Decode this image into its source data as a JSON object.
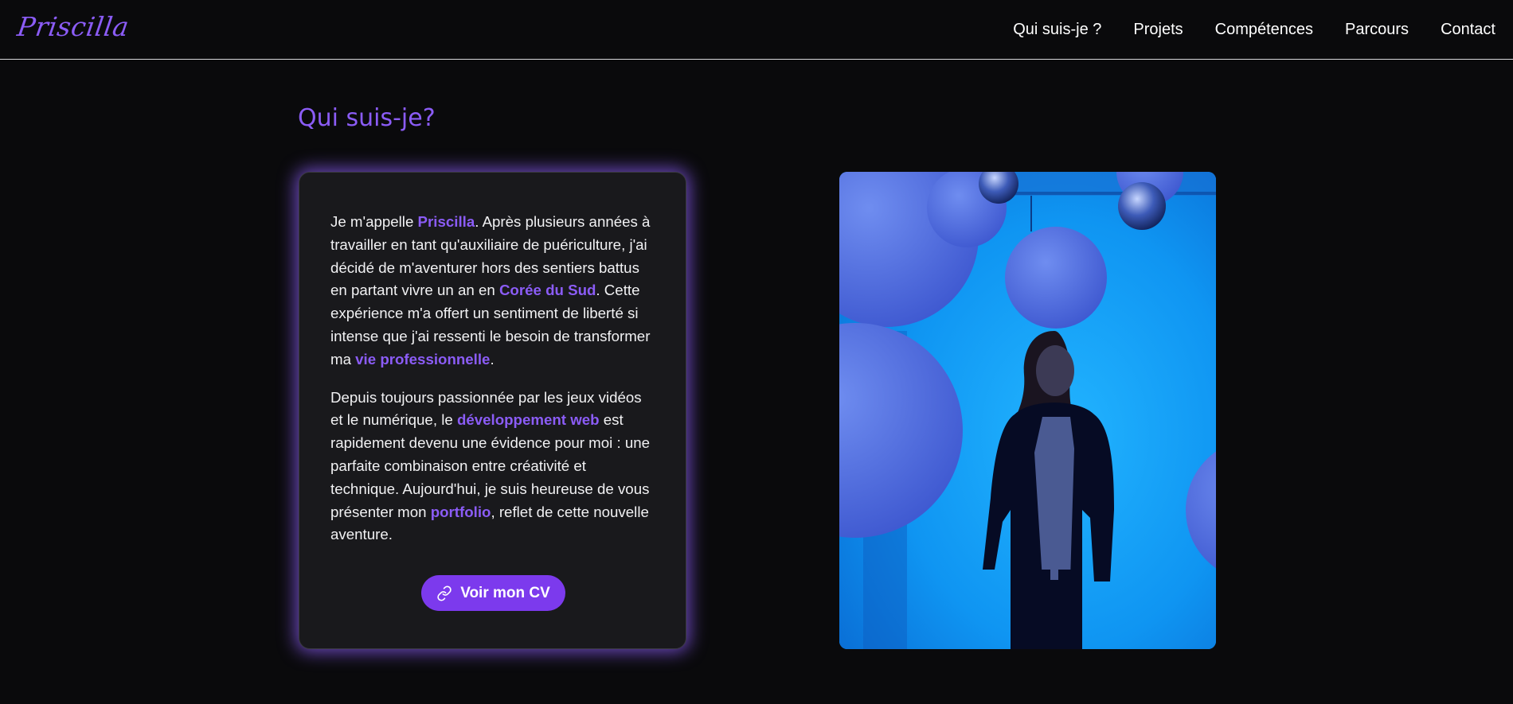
{
  "header": {
    "logo": "Priscilla",
    "nav": [
      {
        "label": "Qui suis-je ?"
      },
      {
        "label": "Projets"
      },
      {
        "label": "Compétences"
      },
      {
        "label": "Parcours"
      },
      {
        "label": "Contact"
      }
    ]
  },
  "about": {
    "title": "Qui suis-je?",
    "paragraph1": {
      "t1": "Je m'appelle ",
      "h1": "Priscilla",
      "t2": ". Après plusieurs années à travailler en tant qu'auxiliaire de puériculture, j'ai décidé de m'aventurer hors des sentiers battus en partant vivre un an en ",
      "h2": "Corée du Sud",
      "t3": ". Cette expérience m'a offert un sentiment de liberté si intense que j'ai ressenti le besoin de transformer ma ",
      "h3": "vie professionnelle",
      "t4": "."
    },
    "paragraph2": {
      "t1": "Depuis toujours passionnée par les jeux vidéos et le numérique, le ",
      "h1": "développement web",
      "t2": " est rapidement devenu une évidence pour moi : une parfaite combinaison entre créativité et technique. Aujourd'hui, je suis heureuse de vous présenter mon ",
      "h2": "portfolio",
      "t3": ", reflet de cette nouvelle aventure."
    },
    "cv_button": {
      "label": "Voir mon CV",
      "icon": "link-icon"
    }
  },
  "photo": {
    "icon": "portrait-photo"
  },
  "colors": {
    "background": "#0a0a0c",
    "accent": "#8b5cf6",
    "button": "#7c3aed",
    "card": "#19191c"
  }
}
